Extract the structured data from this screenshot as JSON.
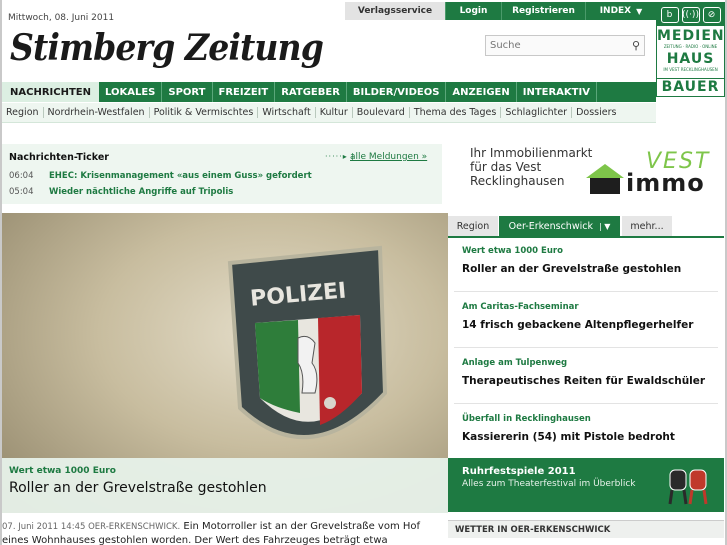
{
  "header": {
    "date": "Mittwoch, 08. Juni 2011",
    "logo_text": "Stimberg Zeitung",
    "top_links": {
      "verlagsservice": "Verlagsservice",
      "login": "Login",
      "registrieren": "Registrieren",
      "index": "INDEX"
    },
    "search_placeholder": "Suche"
  },
  "media_house": {
    "line1": "MEDIEN",
    "small1": "ZEITUNG · RADIO · ONLINE",
    "line2": "HAUS",
    "small2": "IM VEST RECKLINGHAUSEN",
    "line3": "BAUER"
  },
  "main_nav": [
    "NACHRICHTEN",
    "LOKALES",
    "SPORT",
    "FREIZEIT",
    "RATGEBER",
    "BILDER/VIDEOS",
    "ANZEIGEN",
    "INTERAKTIV"
  ],
  "sub_nav": [
    "Region",
    "Nordrhein-Westfalen",
    "Politik & Vermischtes",
    "Wirtschaft",
    "Kultur",
    "Boulevard",
    "Thema des Tages",
    "Schlaglichter",
    "Dossiers"
  ],
  "ticker": {
    "title": "Nachrichten-Ticker",
    "all_link": "alle Meldungen »",
    "items": [
      {
        "time": "06:04",
        "text": "EHEC: Krisenmanagement «aus einem Guss» gefordert"
      },
      {
        "time": "05:04",
        "text": "Wieder nächtliche Angriffe auf Tripolis"
      }
    ]
  },
  "ad": {
    "line1": "Ihr Immobilienmarkt",
    "line2": "für das Vest",
    "line3": "Recklinghausen",
    "logo_top": "VEST",
    "logo_bottom": "immo"
  },
  "hero": {
    "badge_text": "POLIZEI",
    "kicker": "Wert etwa 1000 Euro",
    "title": "Roller an der Grevelstraße gestohlen"
  },
  "teaser": {
    "meta": "07. Juni 2011 14:45 OER-ERKENSCHWICK.",
    "text": "Ein Motorroller ist an der Grevelstraße vom Hof eines Wohnhauses gestohlen worden. Der Wert des Fahrzeuges beträgt etwa"
  },
  "tabs": {
    "region": "Region",
    "ort": "Oer-Erkenschwick",
    "mehr": "mehr..."
  },
  "news": [
    {
      "kicker": "Wert etwa 1000 Euro",
      "headline": "Roller an der Grevelstraße gestohlen"
    },
    {
      "kicker": "Am Caritas-Fachseminar",
      "headline": "14 frisch gebackene Altenpflegerhelfer"
    },
    {
      "kicker": "Anlage am Tulpenweg",
      "headline": "Therapeutisches Reiten für Ewaldschüler"
    },
    {
      "kicker": "Überfall in Recklinghausen",
      "headline": "Kassiererin (54) mit Pistole bedroht"
    }
  ],
  "promo": {
    "title": "Ruhrfestspiele 2011",
    "subtitle": "Alles zum Theaterfestival im Überblick"
  },
  "weiter": "WETTER IN OER-ERKENSCHWICK",
  "colors": {
    "brand_green": "#1e7a42",
    "light_green": "#eef6f0",
    "accent_lime": "#7ec54a"
  }
}
